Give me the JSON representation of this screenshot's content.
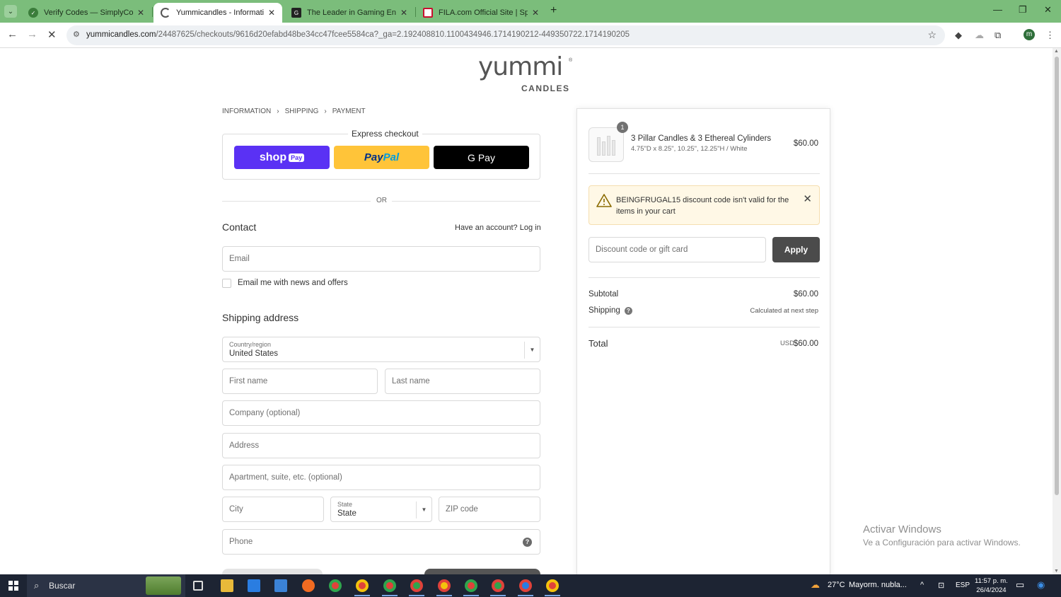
{
  "browser": {
    "tabs": [
      {
        "label": "Verify Codes — SimplyCodes",
        "icon": "simplycodes-icon",
        "active": false
      },
      {
        "label": "Yummicandles - Information - Y",
        "icon": "loading-spinner-icon",
        "active": true
      },
      {
        "label": "The Leader in Gaming Energy &",
        "icon": "gg-icon",
        "active": false
      },
      {
        "label": "FILA.com Official Site | Sportsw",
        "icon": "fila-icon",
        "active": false
      }
    ],
    "url_host": "yummicandles.com",
    "url_path": "/24487625/checkouts/9616d20efabd48be34cc47fcee5584ca?_ga=2.192408810.1100434946.1714190212-449350722.1714190205",
    "profile_initial": "m"
  },
  "logo": {
    "word": "yummi",
    "sub": "CANDLES",
    "mark": "®"
  },
  "breadcrumb": {
    "items": [
      "INFORMATION",
      "SHIPPING",
      "PAYMENT"
    ]
  },
  "express": {
    "title": "Express checkout",
    "shop_label": "shop",
    "shop_pay": "Pay",
    "paypal_a": "Pay",
    "paypal_b": "Pal",
    "gpay": "G Pay",
    "or": "OR"
  },
  "contact": {
    "title": "Contact",
    "login_prompt": "Have an account? Log in",
    "email_placeholder": "Email",
    "newsletter_label": "Email me with news and offers"
  },
  "shipping": {
    "title": "Shipping address",
    "country_label": "Country/region",
    "country_value": "United States",
    "first_name": "First name",
    "last_name": "Last name",
    "company": "Company (optional)",
    "address": "Address",
    "apartment": "Apartment, suite, etc. (optional)",
    "city": "City",
    "state_label": "State",
    "state_value": "State",
    "zip": "ZIP code",
    "phone": "Phone"
  },
  "summary": {
    "item": {
      "qty": "1",
      "name": "3 Pillar Candles & 3 Ethereal Cylinders",
      "variant": "4.75\"D x 8.25\", 10.25\", 12.25\"H / White",
      "price": "$60.00"
    },
    "warning": "BEINGFRUGAL15 discount code isn't valid for the items in your cart",
    "discount_placeholder": "Discount code or gift card",
    "apply_label": "Apply",
    "subtotal_label": "Subtotal",
    "subtotal_value": "$60.00",
    "shipping_label": "Shipping",
    "shipping_value": "Calculated at next step",
    "total_label": "Total",
    "currency": "USD",
    "total_value": "$60.00"
  },
  "windows_activation": {
    "line1": "Activar Windows",
    "line2": "Ve a Configuración para activar Windows."
  },
  "taskbar": {
    "search_text": "Buscar",
    "temperature": "27°C",
    "weather": "Mayorm. nubla...",
    "language": "ESP",
    "time": "11:57 p. m.",
    "date": "26/4/2024"
  }
}
